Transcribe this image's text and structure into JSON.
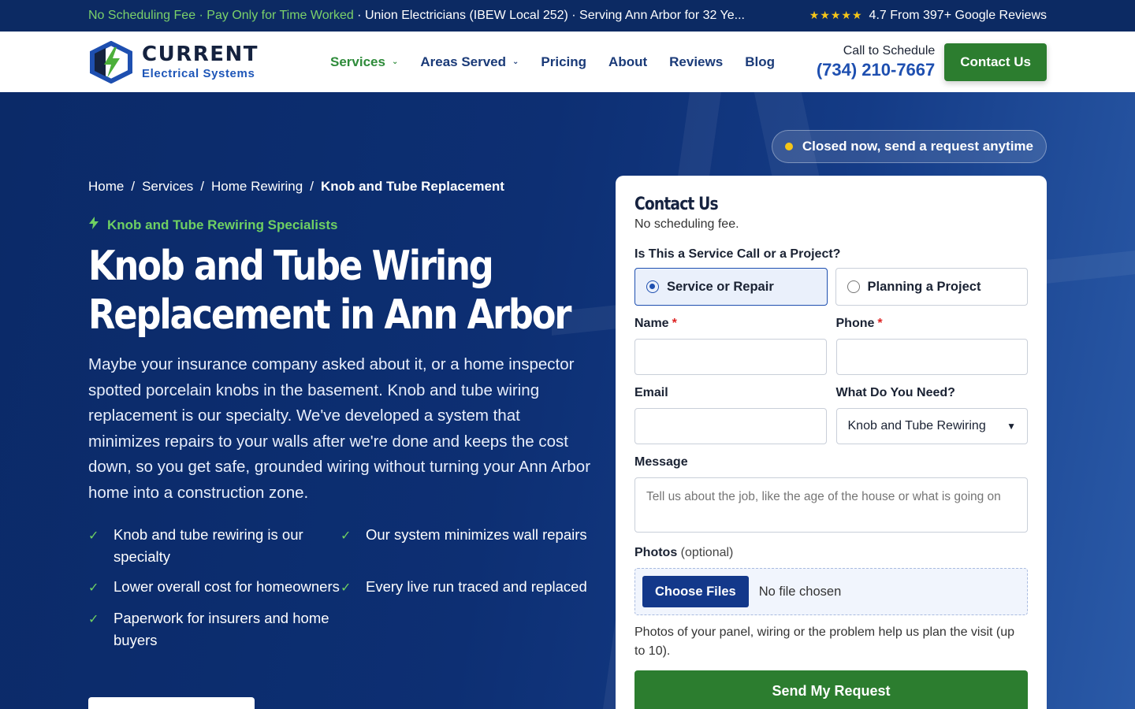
{
  "topbar": {
    "highlight": "No Scheduling Fee · Pay Only for Time Worked",
    "rest": " · Union Electricians (IBEW Local 252) · Serving Ann Arbor for 32 Ye...",
    "stars": "★★★★★",
    "reviews": "4.7 From 397+ Google Reviews"
  },
  "logo": {
    "line1": "CURRENT",
    "line2": "Electrical Systems"
  },
  "nav": {
    "services": "Services",
    "areas": "Areas Served",
    "pricing": "Pricing",
    "about": "About",
    "reviews": "Reviews",
    "blog": "Blog"
  },
  "header": {
    "call_label": "Call to Schedule",
    "phone": "(734) 210-7667",
    "contact": "Contact Us"
  },
  "status": {
    "text": "Closed now, send a request anytime"
  },
  "breadcrumb": {
    "home": "Home",
    "services": "Services",
    "rewiring": "Home Rewiring",
    "current": "Knob and Tube Replacement"
  },
  "hero": {
    "eyebrow": "Knob and Tube Rewiring Specialists",
    "title_line1": "Knob and Tube Wiring",
    "title_line2": "Replacement in Ann Arbor",
    "lead": "Maybe your insurance company asked about it, or a home inspector spotted porcelain knobs in the basement. Knob and tube wiring replacement is our specialty. We've developed a system that minimizes repairs to your walls after we're done and keeps the cost down, so you get safe, grounded wiring without turning your Ann Arbor home into a construction zone.",
    "features": [
      "Knob and tube rewiring is our specialty",
      "Our system minimizes wall repairs",
      "Lower overall cost for homeowners",
      "Every live run traced and replaced",
      "Paperwork for insurers and home buyers"
    ]
  },
  "form": {
    "title": "Contact Us",
    "subtitle": "No scheduling fee.",
    "question": "Is This a Service Call or a Project?",
    "option1": "Service or Repair",
    "option2": "Planning a Project",
    "name_label": "Name",
    "phone_label": "Phone",
    "required_mark": "*",
    "email_label": "Email",
    "need_label": "What Do You Need?",
    "need_value": "Knob and Tube Rewiring",
    "message_label": "Message",
    "message_placeholder": "Tell us about the job, like the age of the house or what is going on",
    "photos_label": "Photos",
    "photos_optional": "(optional)",
    "choose_files": "Choose Files",
    "no_file": "No file chosen",
    "photos_help": "Photos of your panel, wiring or the problem help us plan the visit (up to 10).",
    "submit": "Send My Request"
  }
}
